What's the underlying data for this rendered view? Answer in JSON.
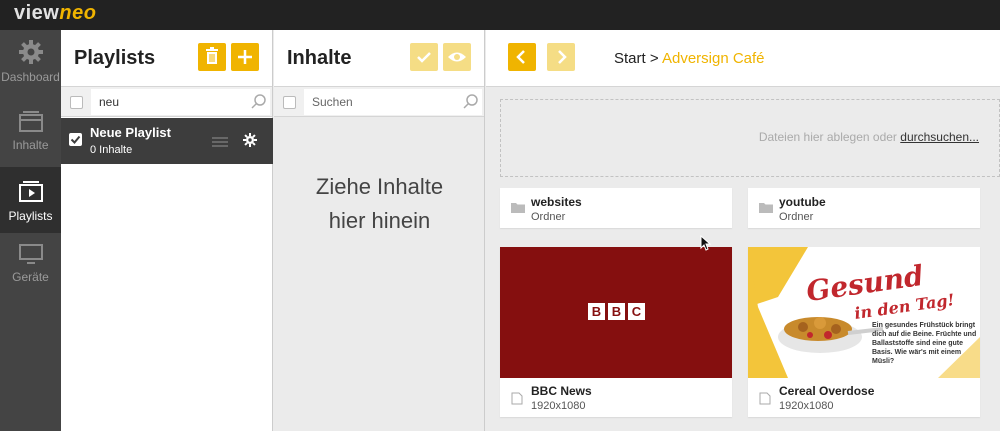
{
  "app": {
    "logo_main": "view",
    "logo_accent": "neo",
    "accent_color": "#f0b400"
  },
  "nav": {
    "items": [
      {
        "label": "Dashboard",
        "icon": "gear-icon",
        "active": false
      },
      {
        "label": "Inhalte",
        "icon": "inbox-icon",
        "active": false
      },
      {
        "label": "Playlists",
        "icon": "playlist-icon",
        "active": true
      },
      {
        "label": "Geräte",
        "icon": "monitor-icon",
        "active": false
      }
    ]
  },
  "playlists": {
    "title": "Playlists",
    "search_value": "neu",
    "items": [
      {
        "name": "Neue Playlist",
        "count": "0 Inhalte",
        "checked": true
      }
    ]
  },
  "inhalte": {
    "title": "Inhalte",
    "search_placeholder": "Suchen",
    "drop_hint_line1": "Ziehe Inhalte",
    "drop_hint_line2": "hier hinein"
  },
  "main": {
    "breadcrumb_root": "Start",
    "breadcrumb_sep": ">",
    "breadcrumb_current": "Adversign Café",
    "dropzone_text": "Dateien hier ablegen oder",
    "dropzone_link": "durchsuchen...",
    "folders": [
      {
        "name": "websites",
        "type": "Ordner"
      },
      {
        "name": "youtube",
        "type": "Ordner"
      }
    ],
    "media": [
      {
        "name": "BBC News",
        "resolution": "1920x1080",
        "thumb_text": [
          "B",
          "B",
          "C"
        ]
      },
      {
        "name": "Cereal Overdose",
        "resolution": "1920x1080",
        "thumb_title": "Gesund",
        "thumb_subtitle": "in den Tag!",
        "thumb_body": "Ein gesundes Frühstück bringt dich auf die Beine. Früchte und Ballaststoffe sind eine gute Basis. Wie wär's mit einem Müsli?"
      }
    ]
  }
}
